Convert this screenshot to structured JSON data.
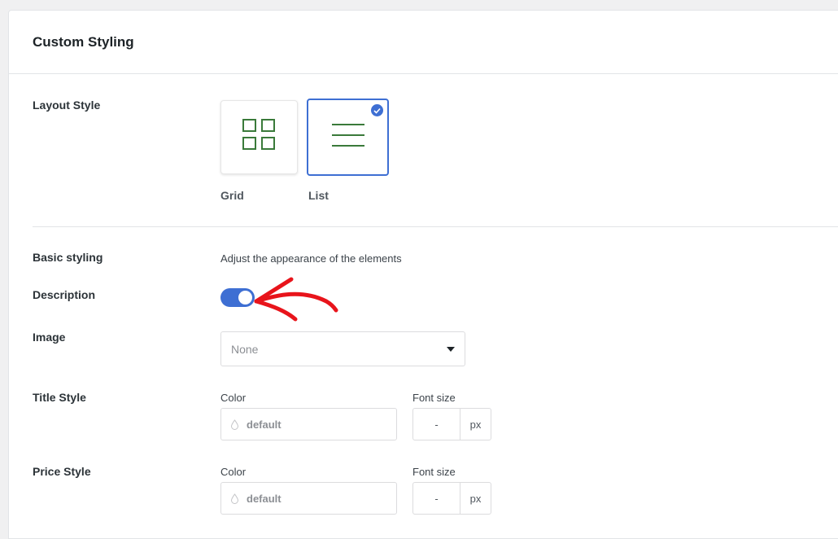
{
  "panel": {
    "title": "Custom Styling"
  },
  "layout": {
    "label": "Layout Style",
    "options": [
      {
        "label": "Grid",
        "selected": false,
        "icon": "grid-icon"
      },
      {
        "label": "List",
        "selected": true,
        "icon": "list-icon"
      }
    ]
  },
  "basic": {
    "label": "Basic styling",
    "helper": "Adjust the appearance of the elements"
  },
  "description": {
    "label": "Description",
    "enabled": true
  },
  "image": {
    "label": "Image",
    "selected": "None"
  },
  "title_style": {
    "label": "Title Style",
    "color_label": "Color",
    "color_value": "default",
    "font_size_label": "Font size",
    "font_size_value": "-",
    "unit": "px"
  },
  "price_style": {
    "label": "Price Style",
    "color_label": "Color",
    "color_value": "default",
    "font_size_label": "Font size",
    "font_size_value": "-",
    "unit": "px"
  },
  "colors": {
    "accent": "#3e6fd3",
    "icon_green": "#3a7a3a",
    "annotation_red": "#e8141b"
  }
}
